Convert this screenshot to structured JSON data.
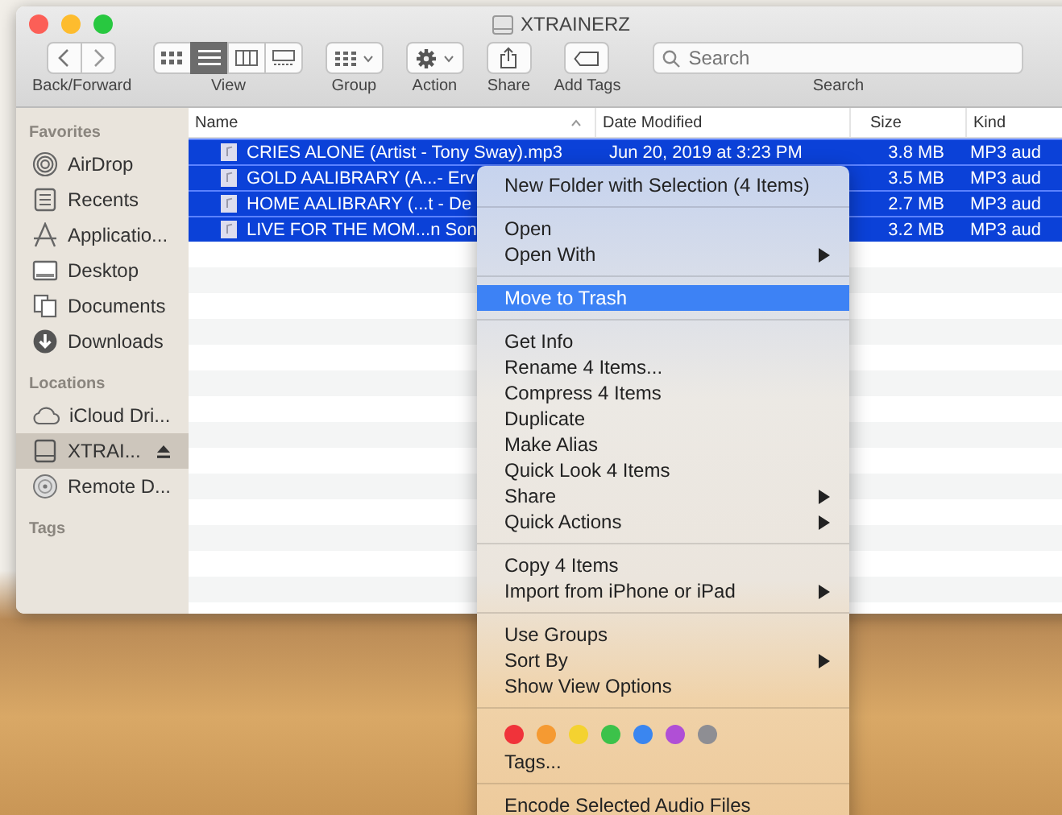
{
  "window": {
    "title": "XTRAINERZ"
  },
  "toolbar": {
    "nav_label": "Back/Forward",
    "view": {
      "label": "View",
      "modes": [
        {
          "selected": false
        },
        {
          "selected": true
        },
        {
          "selected": false
        },
        {
          "selected": false
        }
      ]
    },
    "group_label": "Group",
    "action_label": "Action",
    "share_label": "Share",
    "add_tags_label": "Add Tags",
    "search": {
      "placeholder": "Search",
      "label": "Search"
    }
  },
  "sidebar": {
    "sections": [
      {
        "heading": "Favorites",
        "items": [
          {
            "label": "AirDrop",
            "selected": false
          },
          {
            "label": "Recents",
            "selected": false
          },
          {
            "label": "Applicatio...",
            "selected": false
          },
          {
            "label": "Desktop",
            "selected": false
          },
          {
            "label": "Documents",
            "selected": false
          },
          {
            "label": "Downloads",
            "selected": false
          }
        ]
      },
      {
        "heading": "Locations",
        "items": [
          {
            "label": "iCloud Dri...",
            "selected": false
          },
          {
            "label": "XTRAI...",
            "selected": true,
            "eject": true
          },
          {
            "label": "Remote D...",
            "selected": false
          }
        ]
      },
      {
        "heading": "Tags"
      }
    ]
  },
  "table": {
    "columns": [
      {
        "label": "Name",
        "sorted": true
      },
      {
        "label": "Date Modified",
        "sorted": false
      },
      {
        "label": "Size",
        "sorted": false
      },
      {
        "label": "Kind",
        "sorted": false
      }
    ],
    "rows": [
      {
        "name": "CRIES ALONE (Artist - Tony Sway).mp3",
        "date": "Jun 20, 2019 at 3:23 PM",
        "size": "3.8 MB",
        "kind": "MP3 aud",
        "selected": true
      },
      {
        "name": "GOLD AALIBRARY (A...- Erv",
        "size": "3.5 MB",
        "kind": "MP3 aud",
        "selected": true
      },
      {
        "name": "HOME AALIBRARY (...t - De",
        "size": "2.7 MB",
        "kind": "MP3 aud",
        "selected": true
      },
      {
        "name": "LIVE FOR THE MOM...n Son",
        "size": "3.2 MB",
        "kind": "MP3 aud",
        "selected": true
      }
    ]
  },
  "context_menu": {
    "sections": [
      {
        "kind": "items",
        "items": [
          {
            "label": "New Folder with Selection (4 Items)",
            "submenu": false,
            "highlighted": false
          }
        ]
      },
      {
        "kind": "items",
        "items": [
          {
            "label": "Open",
            "submenu": false,
            "highlighted": false
          },
          {
            "label": "Open With",
            "submenu": true,
            "highlighted": false
          }
        ]
      },
      {
        "kind": "items",
        "items": [
          {
            "label": "Move to Trash",
            "submenu": false,
            "highlighted": true
          }
        ]
      },
      {
        "kind": "items",
        "items": [
          {
            "label": "Get Info",
            "submenu": false,
            "highlighted": false
          },
          {
            "label": "Rename 4 Items...",
            "submenu": false,
            "highlighted": false
          },
          {
            "label": "Compress 4 Items",
            "submenu": false,
            "highlighted": false
          },
          {
            "label": "Duplicate",
            "submenu": false,
            "highlighted": false
          },
          {
            "label": "Make Alias",
            "submenu": false,
            "highlighted": false
          },
          {
            "label": "Quick Look 4 Items",
            "submenu": false,
            "highlighted": false
          },
          {
            "label": "Share",
            "submenu": true,
            "highlighted": false
          },
          {
            "label": "Quick Actions",
            "submenu": true,
            "highlighted": false
          }
        ]
      },
      {
        "kind": "items",
        "items": [
          {
            "label": "Copy 4 Items",
            "submenu": false,
            "highlighted": false
          },
          {
            "label": "Import from iPhone or iPad",
            "submenu": true,
            "highlighted": false
          }
        ]
      },
      {
        "kind": "items",
        "items": [
          {
            "label": "Use Groups",
            "submenu": false,
            "highlighted": false
          },
          {
            "label": "Sort By",
            "submenu": true,
            "highlighted": false
          },
          {
            "label": "Show View Options",
            "submenu": false,
            "highlighted": false
          }
        ]
      },
      {
        "kind": "tags",
        "colors": [
          {
            "color": "#f0333a"
          },
          {
            "color": "#f59a32"
          },
          {
            "color": "#f4d230"
          },
          {
            "color": "#3cc24a"
          },
          {
            "color": "#3a86f0"
          },
          {
            "color": "#b04fd6"
          },
          {
            "color": "#8e8e93"
          }
        ],
        "label": "Tags..."
      },
      {
        "kind": "items",
        "items": [
          {
            "label": "Encode Selected Audio Files",
            "submenu": false,
            "highlighted": false
          }
        ]
      }
    ]
  }
}
